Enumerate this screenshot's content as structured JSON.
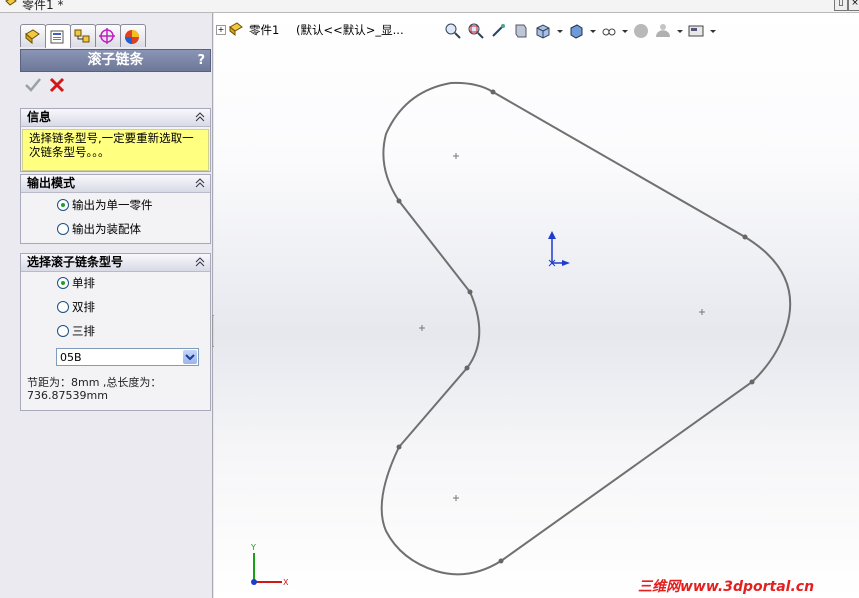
{
  "titlebar": {
    "title": "零件1 *"
  },
  "property_manager": {
    "tabs": [
      "feature-manager",
      "property-manager",
      "configuration-manager",
      "dimxpert-manager",
      "display-manager"
    ],
    "title": "滚子链条",
    "help_label": "?",
    "info_group": {
      "title": "信息",
      "message": "选择链条型号,一定要重新选取一次链条型号。。。"
    },
    "output_group": {
      "title": "输出模式",
      "options": [
        {
          "label": "输出为单一零件",
          "selected": true
        },
        {
          "label": "输出为装配体",
          "selected": false
        }
      ]
    },
    "chain_group": {
      "title": "选择滚子链条型号",
      "options": [
        {
          "label": "单排",
          "selected": true
        },
        {
          "label": "双排",
          "selected": false
        },
        {
          "label": "三排",
          "selected": false
        }
      ],
      "model_value": "05B",
      "pitch_text": "节距为：8mm ,总长度为：736.87539mm"
    }
  },
  "viewport": {
    "tree": {
      "part_name": "零件1",
      "config": "(默认<<默认>_显..."
    },
    "toolbar_icons": [
      "zoom-to-fit-icon",
      "zoom-to-area-icon",
      "previous-view-icon",
      "section-view-icon",
      "view-orientation-icon",
      "display-style-icon",
      "hide-show-items-icon",
      "edit-appearance-icon",
      "apply-scene-icon",
      "view-settings-icon"
    ],
    "axes": {
      "x": "X",
      "y": "Y"
    }
  },
  "watermark": "三维网www.3dportal.cn",
  "colors": {
    "accent": "#6e7898",
    "info_bg": "#ffff80",
    "sketch": "#707070",
    "watermark": "#e32020"
  }
}
